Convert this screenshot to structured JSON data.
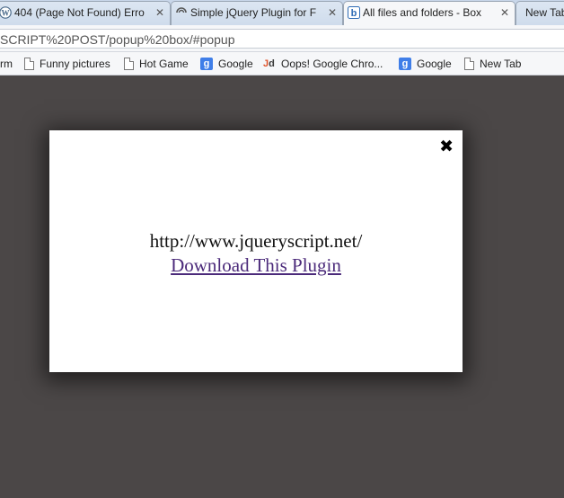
{
  "browser": {
    "tabs": [
      {
        "title": "404 (Page Not Found) Erro",
        "icon": "wordpress-icon",
        "active": false
      },
      {
        "title": "Simple jQuery Plugin for F",
        "icon": "loading-spinner-icon",
        "active": true
      },
      {
        "title": "All files and folders - Box",
        "icon": "box-icon",
        "active": false
      },
      {
        "title": "New Tab",
        "icon": "",
        "active": false
      }
    ],
    "tab_close_glyph": "✕",
    "address": "SCRIPT%20POST/popup%20box/#popup",
    "bookmarks": [
      {
        "label": "rm",
        "icon": ""
      },
      {
        "label": "Funny pictures",
        "icon": "page-icon"
      },
      {
        "label": "Hot Game",
        "icon": "page-icon"
      },
      {
        "label": "Google",
        "icon": "google-icon"
      },
      {
        "label": "Oops! Google Chro...",
        "icon": "jd-icon"
      },
      {
        "label": "Google",
        "icon": "google-icon"
      },
      {
        "label": "New Tab",
        "icon": "page-icon"
      }
    ]
  },
  "popup": {
    "close_glyph": "✖",
    "url_text": "http://www.jqueryscript.net/",
    "link_text": "Download This Plugin"
  },
  "colors": {
    "overlay": "#4b4747",
    "modal": "#ffffff",
    "link": "#4b2a7a"
  }
}
